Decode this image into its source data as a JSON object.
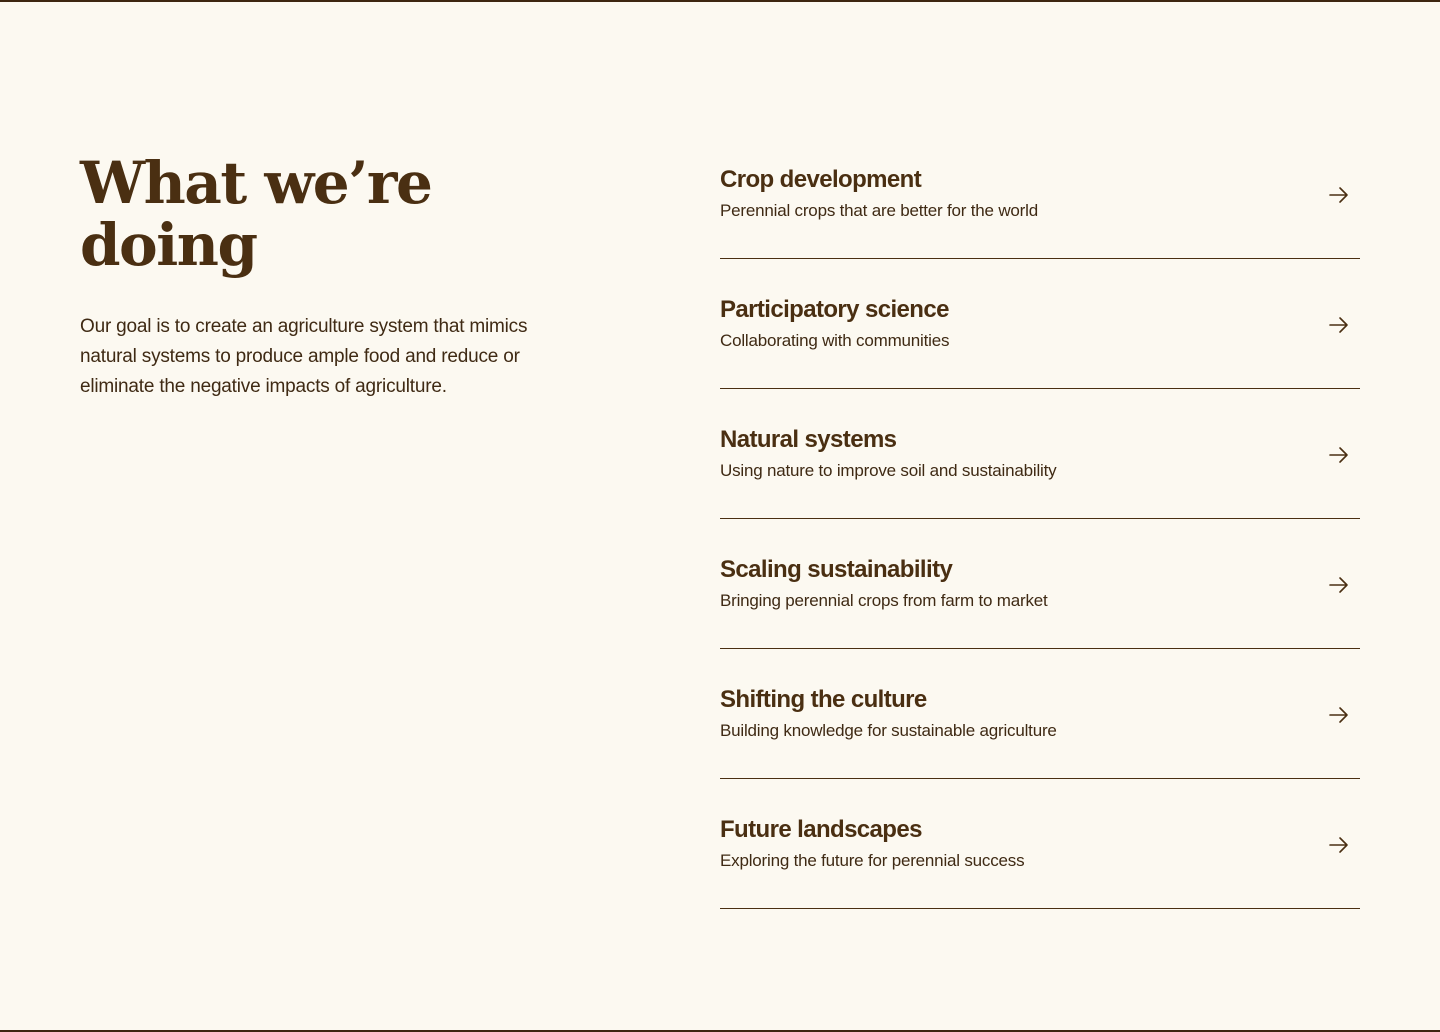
{
  "section": {
    "heading": "What we’re doing",
    "description": "Our goal is to create an agriculture system that mimics natural systems to produce ample food and reduce or eliminate the negative impacts of agriculture."
  },
  "items": [
    {
      "title": "Crop development",
      "subtitle": "Perennial crops that are better for the world",
      "icon": "arrow-right-icon"
    },
    {
      "title": "Participatory science",
      "subtitle": "Collaborating with communities",
      "icon": "arrow-right-icon"
    },
    {
      "title": "Natural systems",
      "subtitle": "Using nature to improve soil and sustainability",
      "icon": "arrow-right-icon"
    },
    {
      "title": "Scaling sustainability",
      "subtitle": "Bringing perennial crops from farm to market",
      "icon": "arrow-right-icon"
    },
    {
      "title": "Shifting the culture",
      "subtitle": "Building knowledge for sustainable agriculture",
      "icon": "arrow-right-icon"
    },
    {
      "title": "Future landscapes",
      "subtitle": "Exploring the future for perennial success",
      "icon": "arrow-right-icon"
    }
  ],
  "colors": {
    "background": "#fcf9f1",
    "text": "#4a2f12",
    "border": "#4a2f12"
  }
}
